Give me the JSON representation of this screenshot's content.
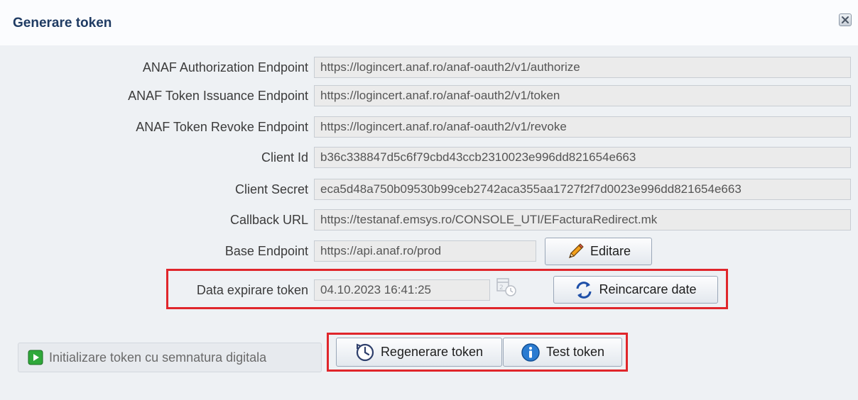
{
  "dialog": {
    "title": "Generare token"
  },
  "fields": [
    {
      "label": "ANAF Authorization Endpoint",
      "value": "https://logincert.anaf.ro/anaf-oauth2/v1/authorize"
    },
    {
      "label": "ANAF Token Issuance Endpoint",
      "value": "https://logincert.anaf.ro/anaf-oauth2/v1/token"
    },
    {
      "label": "ANAF Token Revoke Endpoint",
      "value": "https://logincert.anaf.ro/anaf-oauth2/v1/revoke"
    },
    {
      "label": "Client Id",
      "value": "b36c338847d5c6f79cbd43ccb2310023e996dd821654e663"
    },
    {
      "label": "Client Secret",
      "value": "eca5d48a750b09530b99ceb2742aca355aa1727f2f7d0023e996dd821654e663"
    },
    {
      "label": "Callback URL",
      "value": "https://testanaf.emsys.ro/CONSOLE_UTI/EFacturaRedirect.mk"
    },
    {
      "label": "Base Endpoint",
      "value": "https://api.anaf.ro/prod"
    }
  ],
  "expiry": {
    "label": "Data expirare token",
    "value": "04.10.2023 16:41:25"
  },
  "buttons": {
    "edit": "Editare",
    "reload": "Reincarcare date",
    "init": "Initializare token cu semnatura digitala",
    "regenerate": "Regenerare token",
    "test": "Test token"
  },
  "colors": {
    "highlight": "#e0262b",
    "title": "#1f3b63"
  }
}
